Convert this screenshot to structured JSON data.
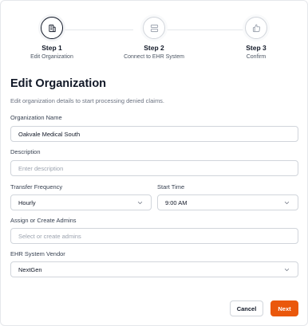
{
  "stepper": {
    "steps": [
      {
        "title": "Step 1",
        "subtitle": "Edit Organization",
        "icon": "building-icon",
        "state": "active"
      },
      {
        "title": "Step 2",
        "subtitle": "Connect to EHR System",
        "icon": "server-icon",
        "state": "inactive"
      },
      {
        "title": "Step 3",
        "subtitle": "Confirm",
        "icon": "thumbs-up-icon",
        "state": "inactive"
      }
    ]
  },
  "form": {
    "title": "Edit Organization",
    "subtitle": "Edit organization details to start processing denied claims.",
    "org_name": {
      "label": "Organization Name",
      "value": "Oakvale Medical South"
    },
    "description": {
      "label": "Description",
      "placeholder": "Enter description"
    },
    "transfer_frequency": {
      "label": "Transfer Frequency",
      "value": "Hourly"
    },
    "start_time": {
      "label": "Start Time",
      "value": "9:00 AM"
    },
    "admins": {
      "label": "Assign or Create Admins",
      "placeholder": "Select or create admins"
    },
    "ehr_vendor": {
      "label": "EHR System Vendor",
      "value": "NextGen"
    }
  },
  "actions": {
    "cancel": "Cancel",
    "next": "Next"
  },
  "colors": {
    "accent": "#ea580c",
    "border": "#d1d5db",
    "muted": "#6b7280"
  }
}
